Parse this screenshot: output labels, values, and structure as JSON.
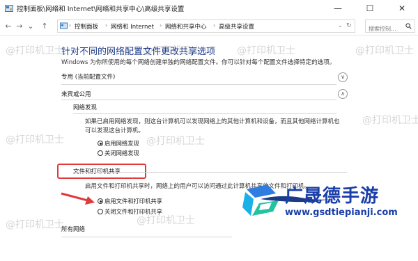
{
  "window": {
    "title": "控制面板\\网络和 Internet\\网络和共享中心\\高级共享设置",
    "minimize": "—",
    "maximize": "☐",
    "close": "✕"
  },
  "nav": {
    "back": "←",
    "forward": "→",
    "dropdown": "⌄",
    "up": "↑",
    "refresh": "↻"
  },
  "breadcrumb": [
    "控制面板",
    "网络和 Internet",
    "网络和共享中心",
    "高级共享设置"
  ],
  "search": {
    "placeholder": "搜索控制..."
  },
  "main": {
    "heading": "针对不同的网络配置文件更改共享选项",
    "description": "Windows 为你所使用的每个网络创建单独的网络配置文件。你可以针对每个配置文件选择特定的选项。",
    "profiles": {
      "private": "专用 (当前配置文件)",
      "guest_public": "来宾或公用",
      "all_networks": "所有网络"
    },
    "network_discovery": {
      "title": "网络发现",
      "text": "如果已启用网络发现，则这台计算机可以发现网络上的其他计算机和设备，而且其他网络计算机也可以发现这台计算机。",
      "options": [
        "启用网络发现",
        "关闭网络发现"
      ],
      "selected": 0
    },
    "file_printer_sharing": {
      "title": "文件和打印机共享",
      "text": "启用文件和打印机共享时，网络上的用户可以访问通过此计算机共享的文件和打印机。",
      "options": [
        "启用文件和打印机共享",
        "关闭文件和打印机共享"
      ],
      "selected": 0
    }
  },
  "watermark": {
    "text": "@打印机卫士"
  },
  "brand": {
    "name": "广晟德手游",
    "url": "www.gsdtiepianji.com"
  },
  "colors": {
    "heading": "#1f3c88",
    "highlight": "#e13a3a",
    "brand": "#1a3fa8"
  }
}
